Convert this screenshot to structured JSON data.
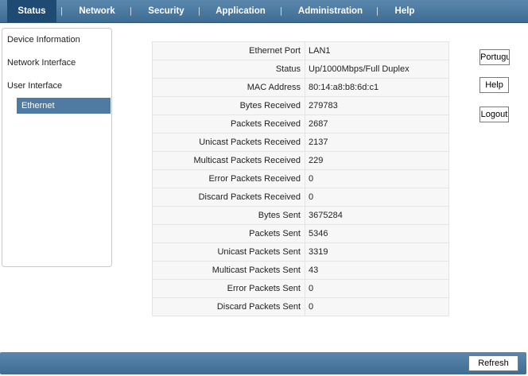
{
  "nav": {
    "items": [
      "Status",
      "Network",
      "Security",
      "Application",
      "Administration",
      "Help"
    ],
    "separator": "|"
  },
  "sidebar": {
    "items": [
      "Device Information",
      "Network Interface",
      "User Interface"
    ],
    "selected": "Ethernet"
  },
  "table": {
    "rows": [
      {
        "label": "Ethernet Port",
        "value": "LAN1"
      },
      {
        "label": "Status",
        "value": "Up/1000Mbps/Full Duplex"
      },
      {
        "label": "MAC Address",
        "value": "80:14:a8:b8:6d:c1"
      },
      {
        "label": "Bytes Received",
        "value": "279783"
      },
      {
        "label": "Packets Received",
        "value": "2687"
      },
      {
        "label": "Unicast Packets Received",
        "value": "2137"
      },
      {
        "label": "Multicast Packets Received",
        "value": "229"
      },
      {
        "label": "Error Packets Received",
        "value": "0"
      },
      {
        "label": "Discard Packets Received",
        "value": "0"
      },
      {
        "label": "Bytes Sent",
        "value": "3675284"
      },
      {
        "label": "Packets Sent",
        "value": "5346"
      },
      {
        "label": "Unicast Packets Sent",
        "value": "3319"
      },
      {
        "label": "Multicast Packets Sent",
        "value": "43"
      },
      {
        "label": "Error Packets Sent",
        "value": "0"
      },
      {
        "label": "Discard Packets Sent",
        "value": "0"
      }
    ]
  },
  "buttons": {
    "language": "Portugu",
    "help": "Help",
    "logout": "Logout",
    "refresh": "Refresh"
  },
  "colors": {
    "nav_bar": "#4a779e",
    "nav_active": "#1f4a74",
    "sidebar_selected": "#4f7ba3"
  }
}
